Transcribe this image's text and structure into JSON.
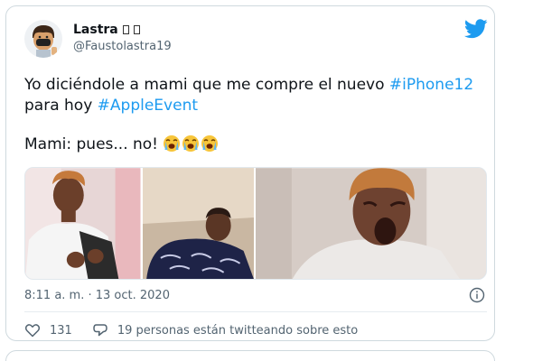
{
  "tweet": {
    "author_name": "Lastra",
    "author_handle": "@Faustolastra19",
    "text_line1_plain": "Yo diciéndole a mami que me compre el nuevo ",
    "hashtag1": "#iPhone12",
    "text_line2_plain": "para hoy ",
    "hashtag2": "#AppleEvent",
    "text_line3_plain": "Mami: pues... no! ",
    "timestamp": "8:11 a. m. · 13 oct. 2020",
    "likes_count": "131",
    "reply_label": "19 personas están twitteando sobre esto"
  },
  "icons": {
    "logo": "twitter-bird-icon",
    "emoji": "loudly-crying-face-icon",
    "info": "info-icon",
    "like": "heart-icon",
    "reply": "speech-bubble-icon"
  },
  "colors": {
    "accent": "#1d9bf0",
    "text": "#0f1419",
    "muted": "#536471",
    "border": "#cfd9de"
  }
}
